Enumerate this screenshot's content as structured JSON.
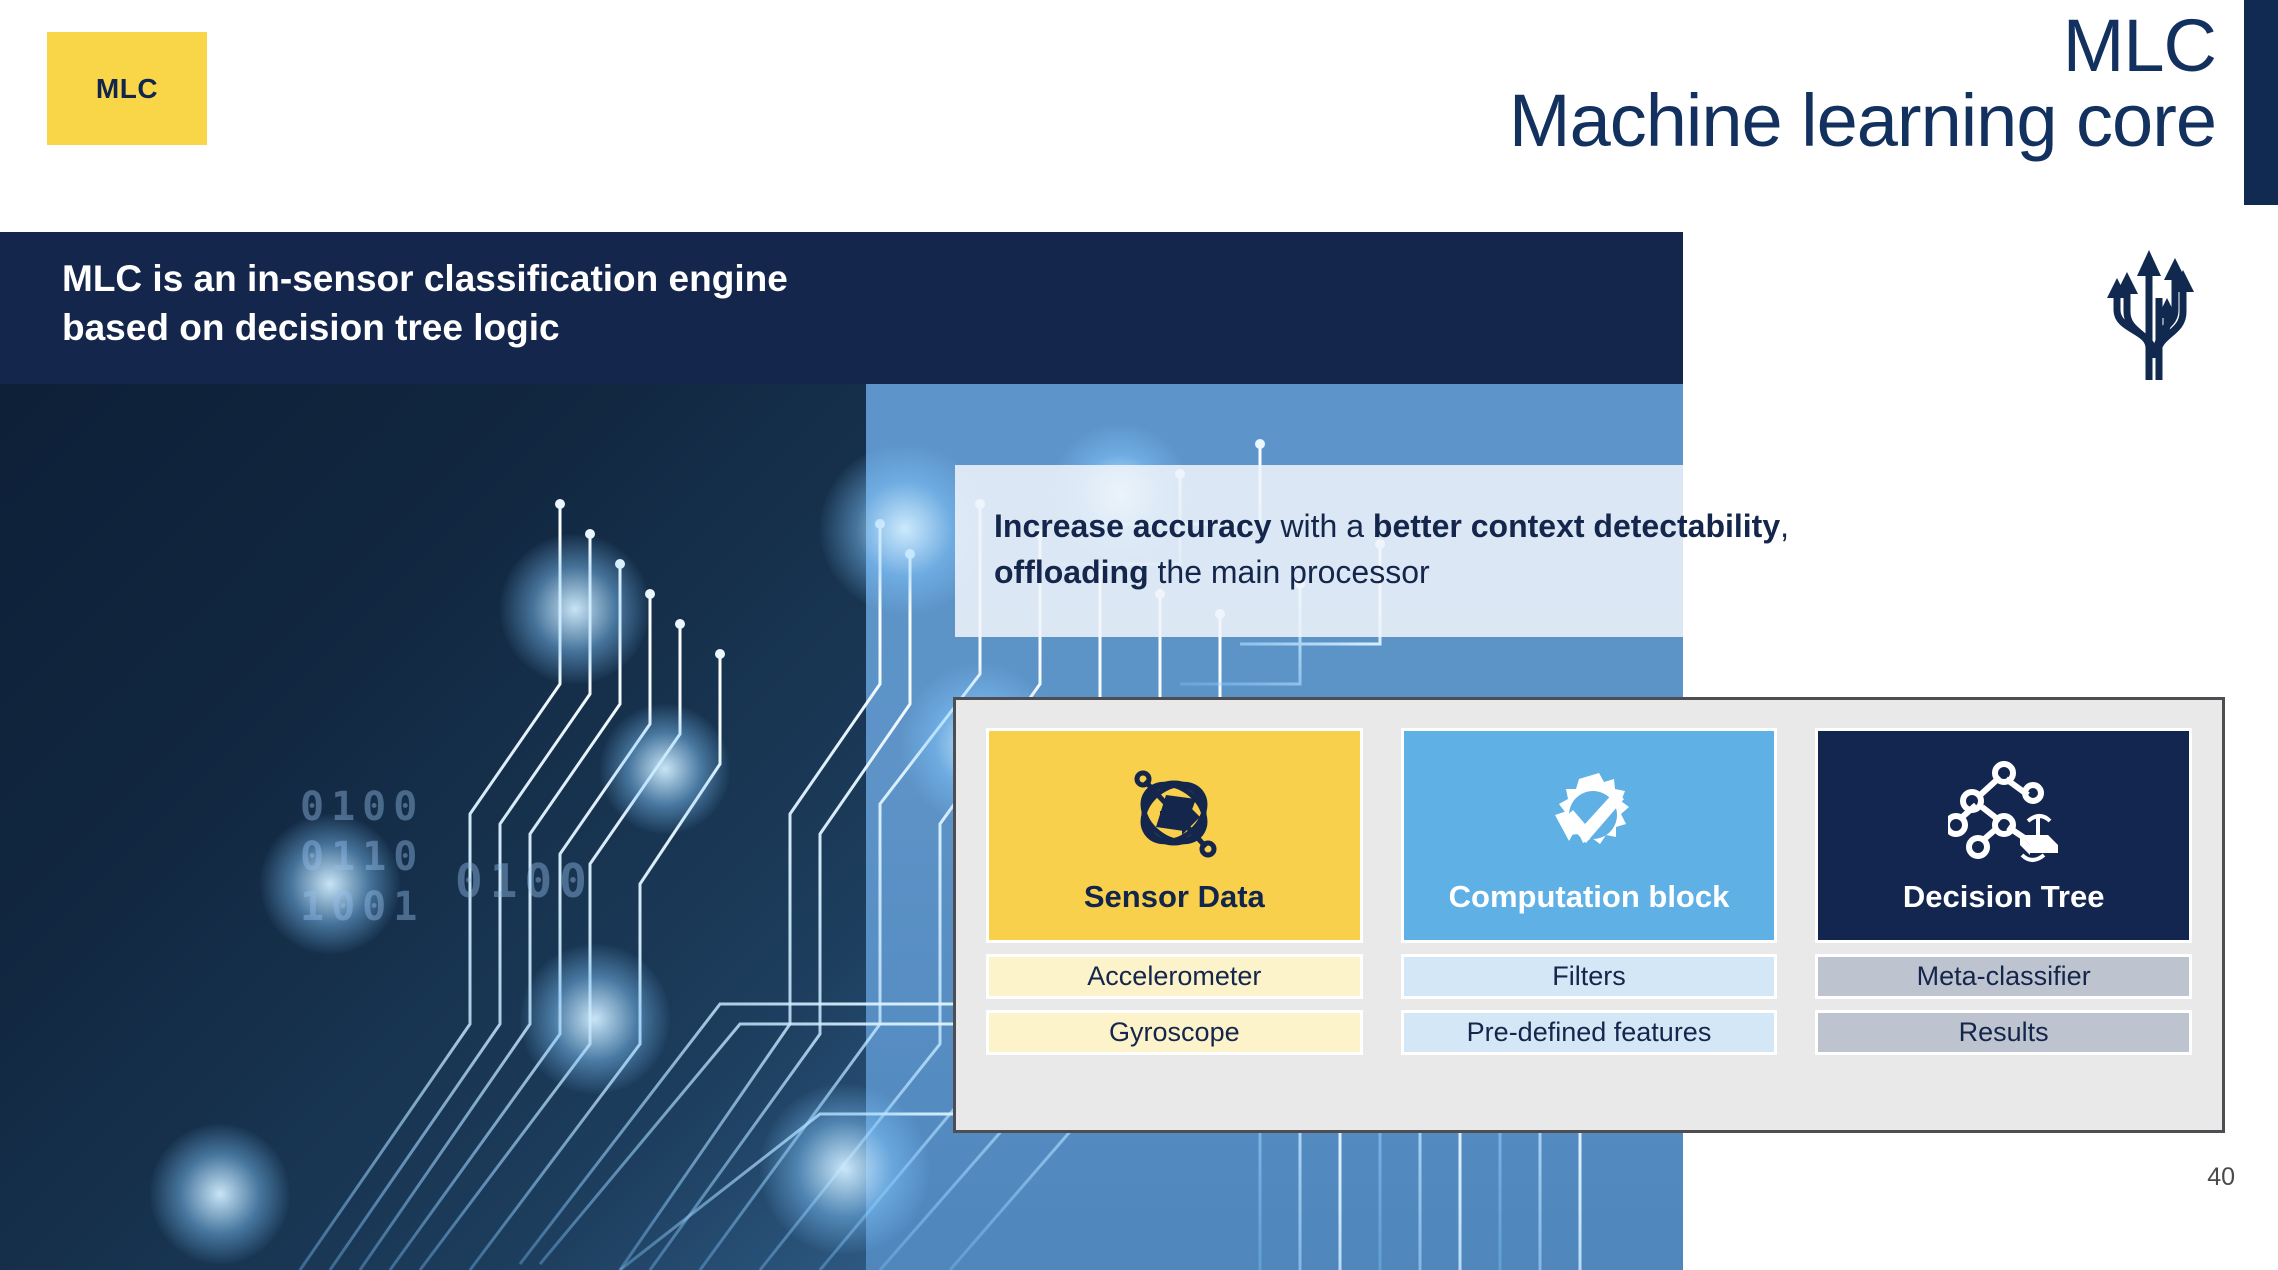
{
  "slide": {
    "badge_label": "MLC",
    "title_line1": "MLC",
    "title_line2": "Machine learning core",
    "page_number": "40",
    "banner_line1": "MLC is an in-sensor classification engine",
    "banner_line2": "based on decision tree logic",
    "callout": {
      "seg1_bold": "Increase accuracy",
      "seg2": " with a ",
      "seg3_bold": "better context detectability",
      "seg4": ",",
      "seg5_bold": "offloading",
      "seg6": " the main processor"
    },
    "branch_icon_name": "branching-arrows-icon",
    "binary_decor": [
      "0100",
      "0110",
      "1001",
      "0100"
    ]
  },
  "colors": {
    "navy": "#14264b",
    "yellow": "#f8d04b",
    "blue": "#5fb0e5",
    "panel_bg": "#e9e9e9",
    "title_navy": "#13315e"
  },
  "panel": {
    "columns": [
      {
        "theme": "c-yellow",
        "icon": "sensor-orbit-icon",
        "title": "Sensor Data",
        "items": [
          "Accelerometer",
          "Gyroscope"
        ]
      },
      {
        "theme": "c-blue",
        "icon": "gear-check-icon",
        "title": "Computation block",
        "items": [
          "Filters",
          "Pre-defined features"
        ]
      },
      {
        "theme": "c-navy",
        "icon": "decision-tree-icon",
        "title": "Decision Tree",
        "items": [
          "Meta-classifier",
          "Results"
        ]
      }
    ]
  }
}
